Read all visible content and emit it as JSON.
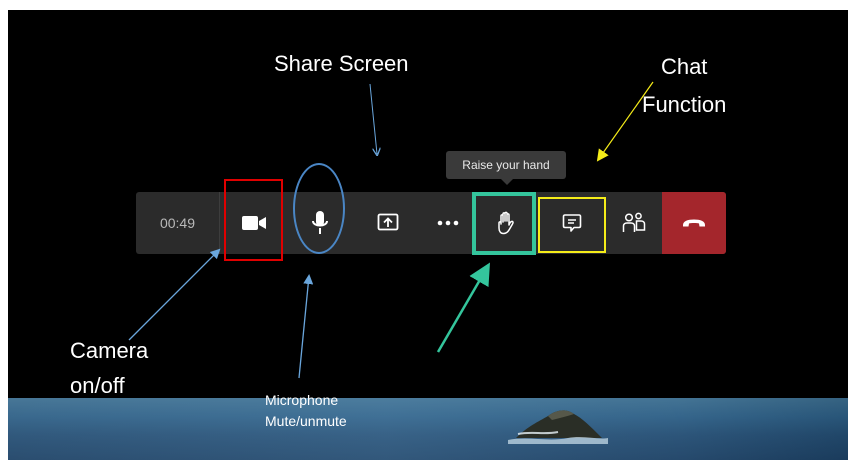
{
  "toolbar": {
    "timer": "00:49",
    "buttons": [
      {
        "name": "camera",
        "icon": "video-camera-icon"
      },
      {
        "name": "microphone",
        "icon": "microphone-icon"
      },
      {
        "name": "share-screen",
        "icon": "share-screen-icon"
      },
      {
        "name": "more-actions",
        "icon": "ellipsis-icon"
      },
      {
        "name": "raise-hand",
        "icon": "hand-icon"
      },
      {
        "name": "chat",
        "icon": "chat-icon"
      },
      {
        "name": "participants",
        "icon": "people-icon"
      },
      {
        "name": "hang-up",
        "icon": "phone-hangup-icon"
      }
    ]
  },
  "tooltip": {
    "text": "Raise your hand"
  },
  "annotations": {
    "share_screen": "Share Screen",
    "chat_function": "Chat\nFunction",
    "camera": "Camera\non/off",
    "microphone": "Microphone\nMute/unmute"
  },
  "colors": {
    "background": "#000000",
    "toolbar": "#2b2b2b",
    "hangup": "#a4262c",
    "camera_highlight": "#e00000",
    "mic_highlight": "#4a86c5",
    "hand_highlight": "#34c59c",
    "chat_highlight": "#f5ec19",
    "arrow_blue": "#6aa6dc",
    "arrow_yellow": "#f5ec19",
    "arrow_green": "#34c59c"
  }
}
